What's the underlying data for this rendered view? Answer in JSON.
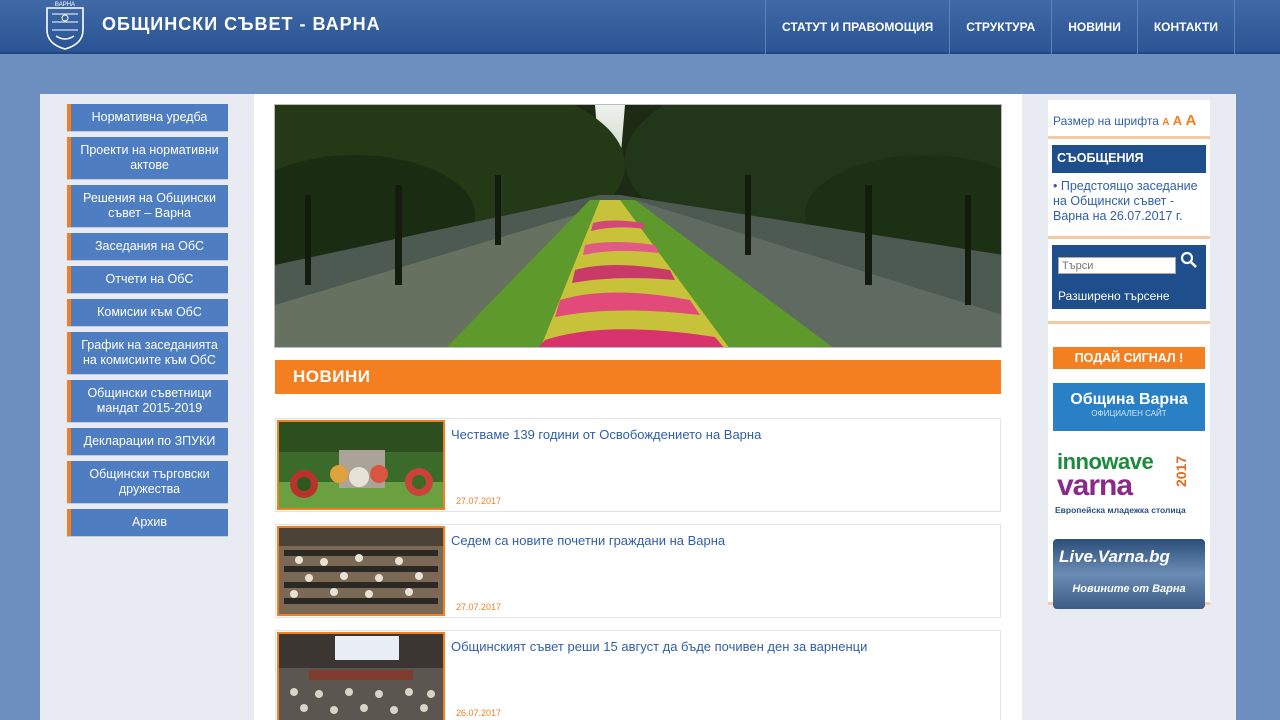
{
  "header": {
    "site_title": "ОБЩИНСКИ СЪВЕТ - ВАРНА",
    "logo_text": "ВАРНА",
    "nav": [
      {
        "label": "СТАТУТ И ПРАВОМОЩИЯ"
      },
      {
        "label": "СТРУКТУРА"
      },
      {
        "label": "НОВИНИ"
      },
      {
        "label": "КОНТАКТИ"
      }
    ]
  },
  "left_menu": {
    "items": [
      {
        "label": "Нормативна уредба"
      },
      {
        "label": "Проекти на нормативни актове"
      },
      {
        "label": "Решения на Общински съвет – Варна"
      },
      {
        "label": "Заседания на ОбС"
      },
      {
        "label": "Отчети на ОбС"
      },
      {
        "label": "Комисии към ОбС"
      },
      {
        "label": "График на заседанията на комисиите към ОбС"
      },
      {
        "label": "Общински съветници мандат 2015-2019"
      },
      {
        "label": "Декларации по ЗПУКИ"
      },
      {
        "label": "Общински търговски дружества"
      },
      {
        "label": "Архив"
      }
    ]
  },
  "news": {
    "heading": "НОВИНИ",
    "items": [
      {
        "title": "Честваме 139 години от Освобождението на Варна",
        "date": "27.07.2017"
      },
      {
        "title": "Седем са новите почетни граждани на Варна",
        "date": "27.07.2017"
      },
      {
        "title": "Общинският съвет реши 15 август да бъде почивен ден за варненци",
        "date": "26.07.2017"
      }
    ]
  },
  "right": {
    "font_size_label": "Размер на шрифта",
    "font_a1": "A",
    "font_a2": "A",
    "font_a3": "A",
    "messages_heading": "СЪОБЩЕНИЯ",
    "message_text": "• Предстоящо заседание на Общински съвет - Варна на 26.07.2017 г.",
    "search_placeholder": "Търси",
    "advanced_search": "Разширено търсене",
    "signal_button": "ПОДАЙ СИГНАЛ !",
    "obshtina_title": "Община Варна",
    "obshtina_sub": "ОФИЦИАЛЕН САЙТ",
    "innowave_title": "innowave",
    "innowave_varna": "varna",
    "innowave_year": "2017",
    "innowave_sub": "Европейска младежка столица",
    "live_title": "Live.Varna.bg",
    "live_sub": "Новините от Варна"
  },
  "colors": {
    "accent": "#f47f20",
    "header": "#2a5494",
    "menu": "#4e7dc2",
    "link": "#2f5fa8"
  }
}
